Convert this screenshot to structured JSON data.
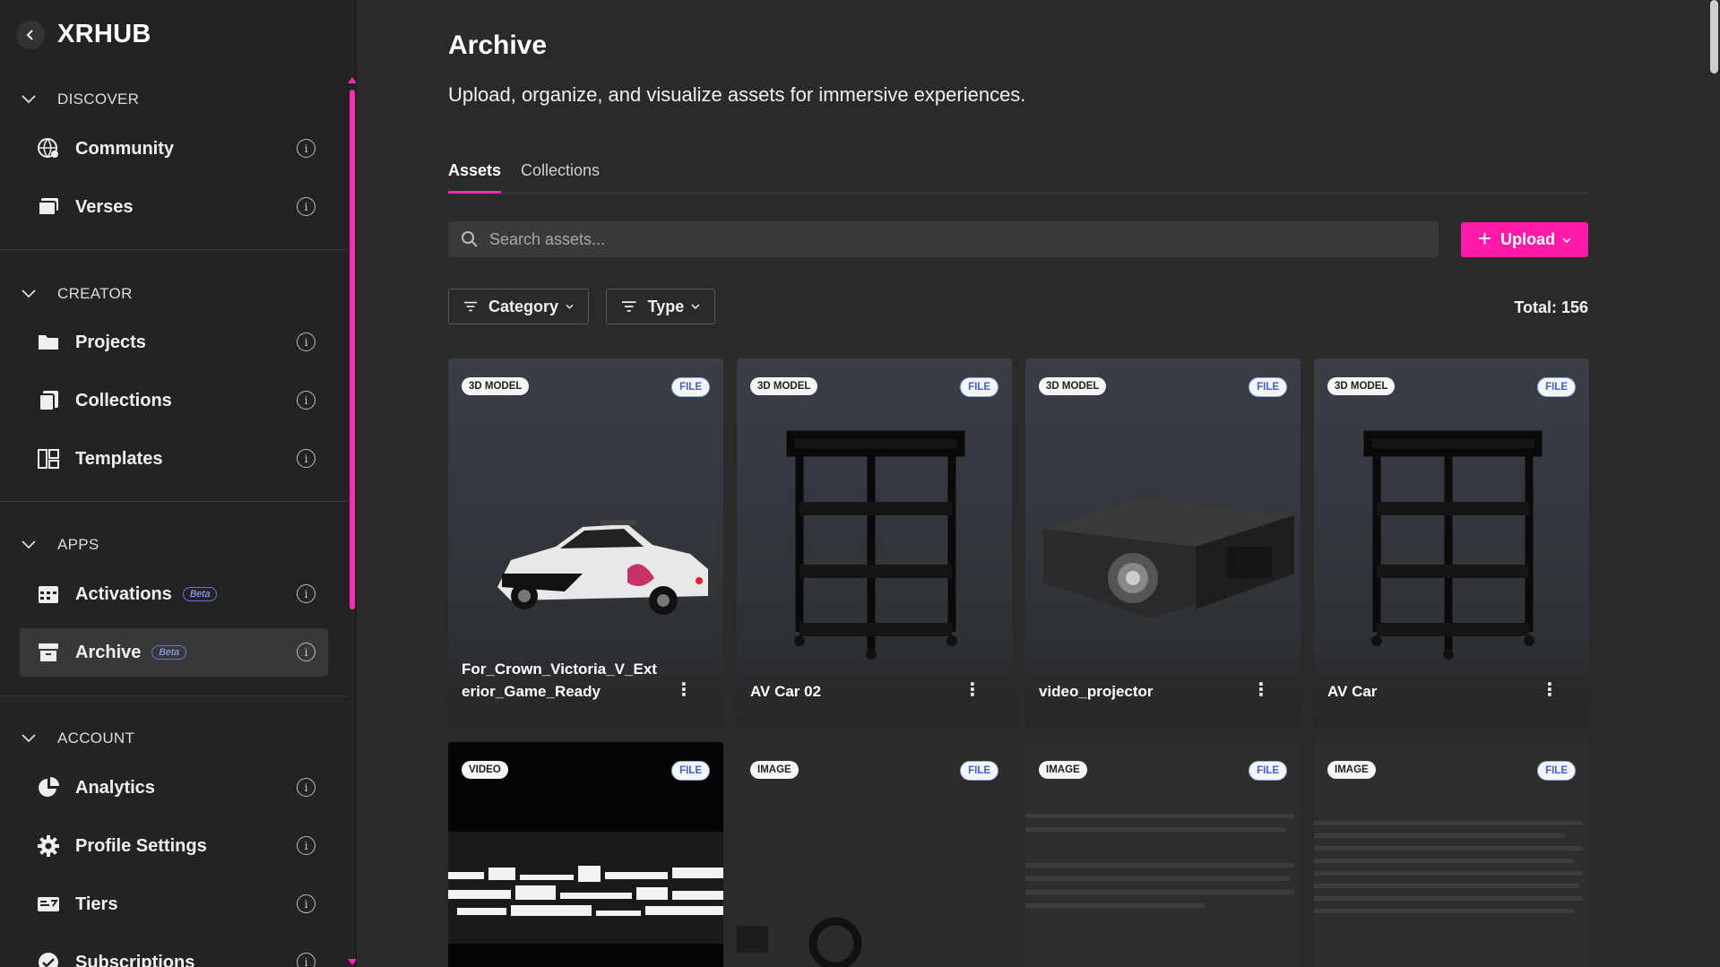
{
  "brand": {
    "name": "XRHUB"
  },
  "sidebar": {
    "sections": [
      {
        "title": "DISCOVER",
        "items": [
          {
            "label": "Community",
            "icon": "globe-users-icon"
          },
          {
            "label": "Verses",
            "icon": "stack-icon"
          }
        ]
      },
      {
        "title": "CREATOR",
        "items": [
          {
            "label": "Projects",
            "icon": "folder-icon"
          },
          {
            "label": "Collections",
            "icon": "collections-icon"
          },
          {
            "label": "Templates",
            "icon": "templates-icon"
          }
        ]
      },
      {
        "title": "APPS",
        "items": [
          {
            "label": "Activations",
            "icon": "calendar-icon",
            "badge": "Beta"
          },
          {
            "label": "Archive",
            "icon": "archive-icon",
            "badge": "Beta",
            "active": true
          }
        ]
      },
      {
        "title": "ACCOUNT",
        "items": [
          {
            "label": "Analytics",
            "icon": "analytics-icon"
          },
          {
            "label": "Profile Settings",
            "icon": "gear-icon"
          },
          {
            "label": "Tiers",
            "icon": "tiers-icon"
          },
          {
            "label": "Subscriptions",
            "icon": "check-circle-icon"
          }
        ]
      }
    ]
  },
  "main": {
    "title": "Archive",
    "subtitle": "Upload, organize, and visualize assets for immersive experiences.",
    "tabs": [
      {
        "label": "Assets",
        "active": true
      },
      {
        "label": "Collections",
        "active": false
      }
    ],
    "search": {
      "placeholder": "Search assets..."
    },
    "upload_label": "Upload",
    "filters": [
      {
        "label": "Category"
      },
      {
        "label": "Type"
      }
    ],
    "total": "Total: 156",
    "cards": [
      {
        "type": "3D MODEL",
        "badge": "FILE",
        "name": "For_Crown_Victoria_V_Exterior_Game_Ready",
        "thumb": "police-car"
      },
      {
        "type": "3D MODEL",
        "badge": "FILE",
        "name": "AV Car 02",
        "thumb": "av-cart"
      },
      {
        "type": "3D MODEL",
        "badge": "FILE",
        "name": "video_projector",
        "thumb": "projector"
      },
      {
        "type": "3D MODEL",
        "badge": "FILE",
        "name": "AV Car",
        "thumb": "av-cart"
      },
      {
        "type": "VIDEO",
        "badge": "FILE",
        "name": "",
        "thumb": "video-glitch"
      },
      {
        "type": "IMAGE",
        "badge": "FILE",
        "name": "",
        "thumb": "image-logo"
      },
      {
        "type": "IMAGE",
        "badge": "FILE",
        "name": "",
        "thumb": "image-text"
      },
      {
        "type": "IMAGE",
        "badge": "FILE",
        "name": "",
        "thumb": "image-text"
      }
    ]
  },
  "colors": {
    "accent": "#ff1aa8",
    "sidebar_bg": "#232323",
    "main_bg": "#2a2a2a"
  }
}
